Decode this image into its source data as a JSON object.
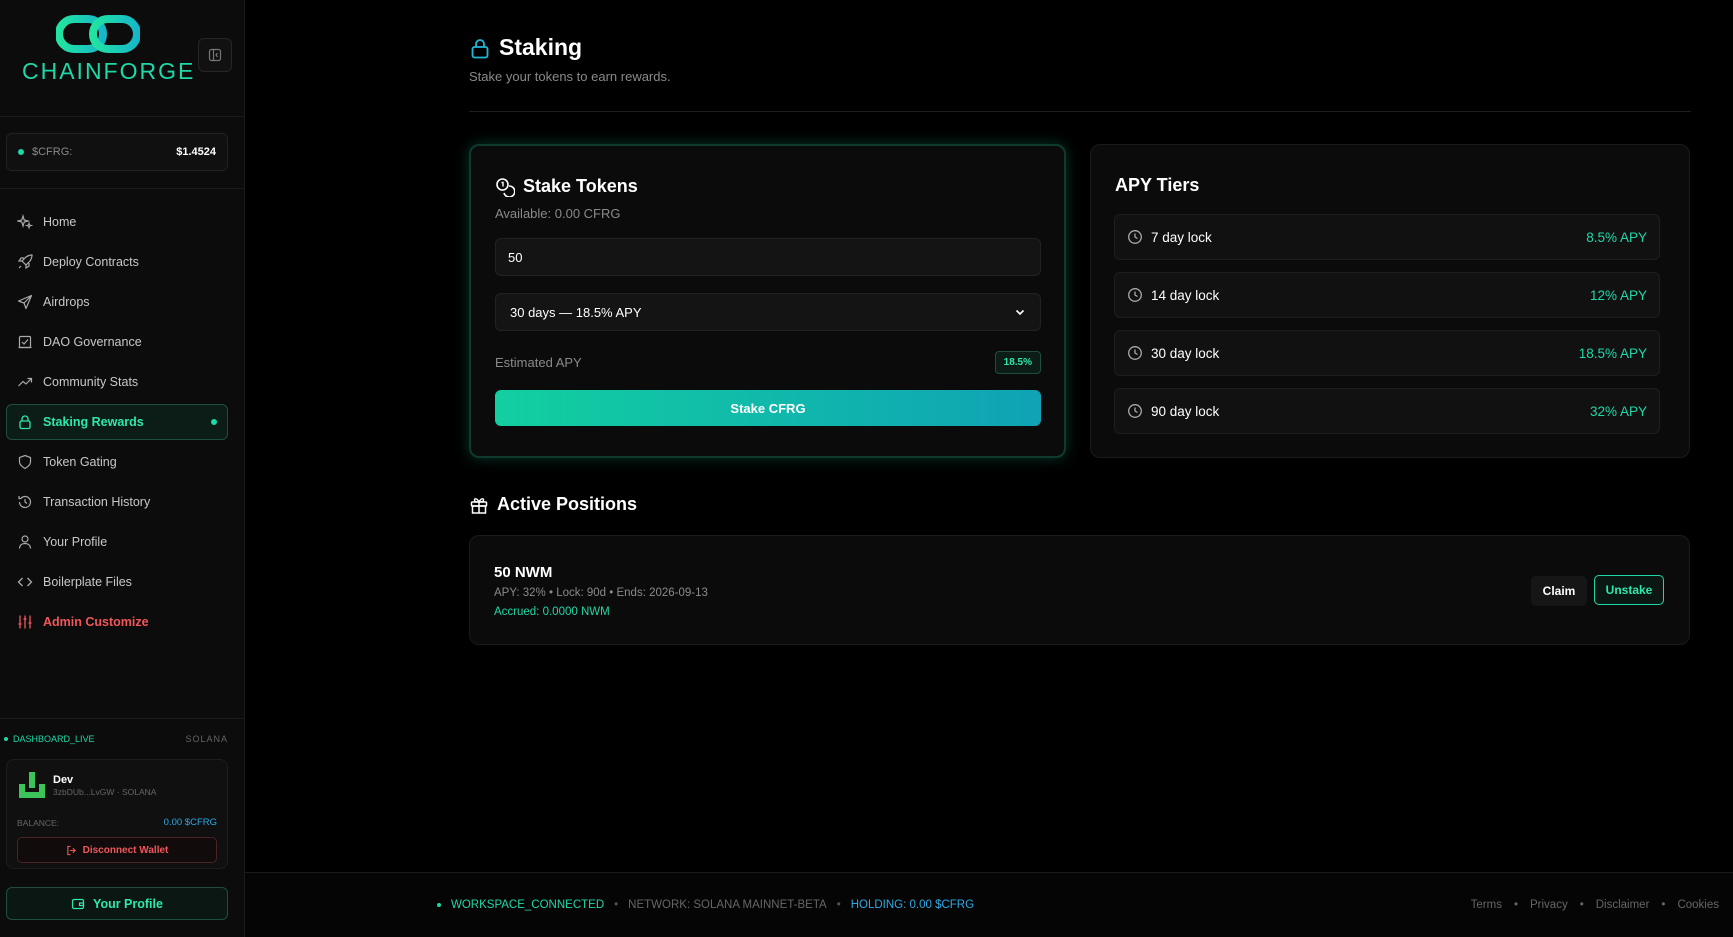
{
  "brand": {
    "name": "CHAINFORGE",
    "accent": "#1fd8a8"
  },
  "price": {
    "label": "$CFRG:",
    "value": "$1.4524"
  },
  "nav": [
    {
      "label": "Home",
      "icon": "sparkle-icon"
    },
    {
      "label": "Deploy Contracts",
      "icon": "rocket-icon"
    },
    {
      "label": "Airdrops",
      "icon": "send-icon"
    },
    {
      "label": "DAO Governance",
      "icon": "vote-icon"
    },
    {
      "label": "Community Stats",
      "icon": "trend-icon"
    },
    {
      "label": "Staking Rewards",
      "icon": "lock-icon",
      "active": true
    },
    {
      "label": "Token Gating",
      "icon": "shield-icon"
    },
    {
      "label": "Transaction History",
      "icon": "history-icon"
    },
    {
      "label": "Your Profile",
      "icon": "user-icon"
    },
    {
      "label": "Boilerplate Files",
      "icon": "code-icon"
    },
    {
      "label": "Admin Customize",
      "icon": "sliders-icon",
      "admin": true
    }
  ],
  "status": {
    "live": "DASHBOARD_LIVE",
    "chain": "SOLANA"
  },
  "wallet": {
    "name": "Dev",
    "address": "3zbDUb...LvGW · SOLANA",
    "balance_label": "BALANCE:",
    "balance": "0.00 $CFRG",
    "disconnect_label": "Disconnect Wallet"
  },
  "profile_button": "Your Profile",
  "page": {
    "title": "Staking",
    "subtitle": "Stake your tokens to earn rewards."
  },
  "stake": {
    "title": "Stake Tokens",
    "available": "Available: 0.00 CFRG",
    "amount": "50",
    "selected_lock": "30 days — 18.5% APY",
    "estimated_label": "Estimated APY",
    "estimated_value": "18.5%",
    "button_label": "Stake CFRG"
  },
  "tiers": {
    "title": "APY Tiers",
    "items": [
      {
        "label": "7 day lock",
        "apy": "8.5% APY"
      },
      {
        "label": "14 day lock",
        "apy": "12% APY"
      },
      {
        "label": "30 day lock",
        "apy": "18.5% APY"
      },
      {
        "label": "90 day lock",
        "apy": "32% APY"
      }
    ]
  },
  "positions": {
    "title": "Active Positions",
    "items": [
      {
        "amount": "50 NWM",
        "meta": "APY: 32% • Lock: 90d • Ends: 2026-09-13",
        "accrued": "Accrued: 0.0000 NWM",
        "claim_label": "Claim",
        "unstake_label": "Unstake"
      }
    ]
  },
  "footer": {
    "workspace": "WORKSPACE_CONNECTED",
    "network": "NETWORK: SOLANA MAINNET-BETA",
    "holding": "HOLDING: 0.00 $CFRG",
    "sep": "•",
    "links": [
      "Terms",
      "Privacy",
      "Disclaimer",
      "Cookies"
    ]
  }
}
